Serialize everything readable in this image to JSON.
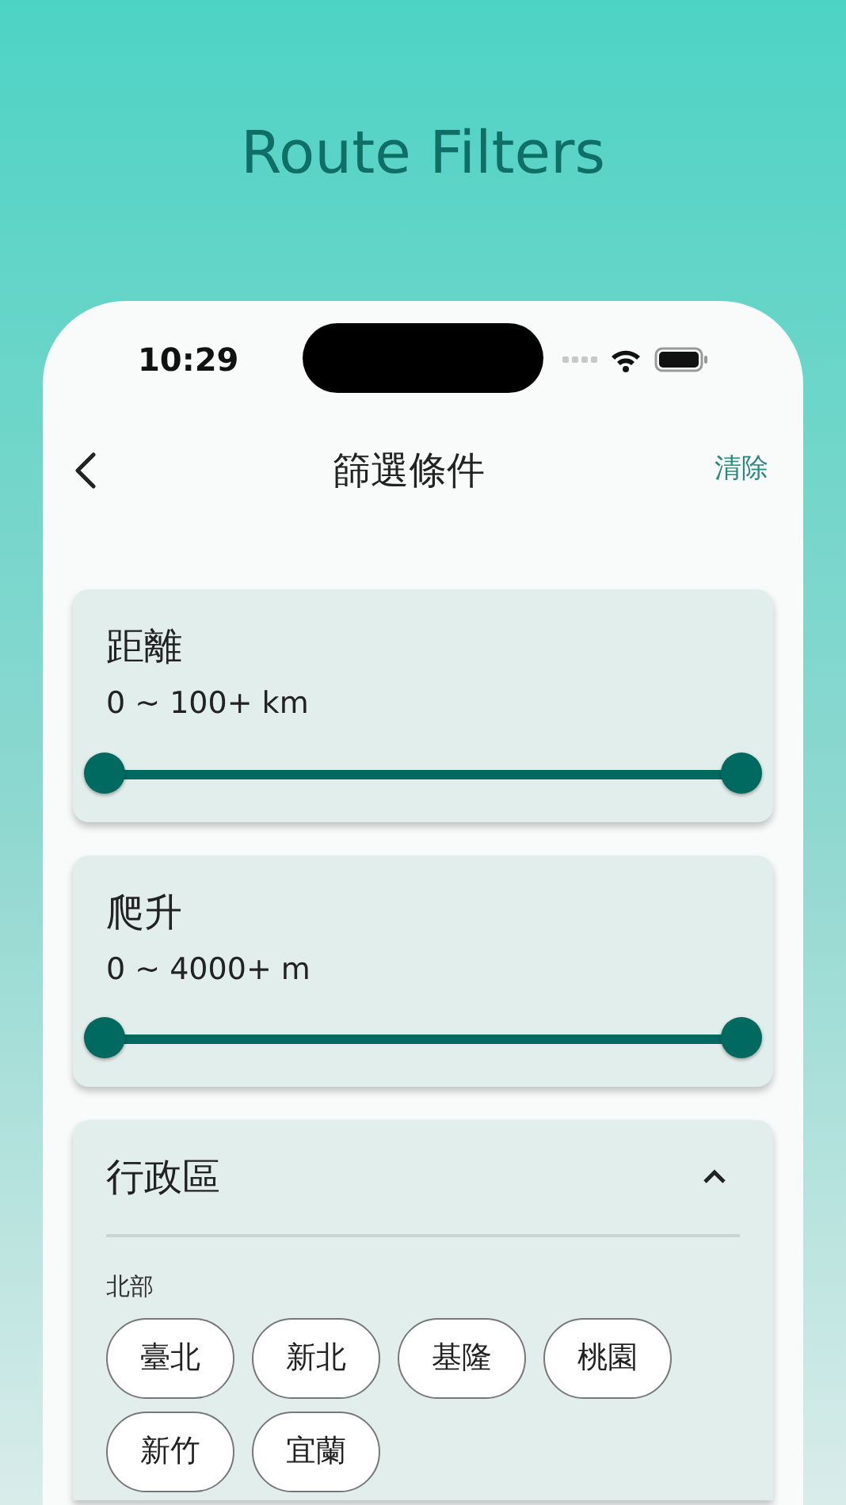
{
  "headline": "Route Filters",
  "status_bar": {
    "time": "10:29"
  },
  "nav": {
    "title": "篩選條件",
    "action": "清除"
  },
  "filters": [
    {
      "title": "距離",
      "reading": "0 ~ 100+ km",
      "thumbs": [
        {
          "level": 0
        },
        {
          "level": 1
        }
      ]
    },
    {
      "title": "爬升",
      "reading": "0 ~ 4000+ m",
      "thumbs": [
        {
          "level": 0
        },
        {
          "level": 1
        }
      ]
    }
  ],
  "region": {
    "title": "行政區",
    "expanded": true,
    "groups": [
      {
        "label": "北部",
        "chips": [
          {
            "label": "臺北",
            "selected": false
          },
          {
            "label": "新北",
            "selected": false
          },
          {
            "label": "基隆",
            "selected": false
          },
          {
            "label": "桃園",
            "selected": false
          },
          {
            "label": "新竹",
            "selected": false
          },
          {
            "label": "宜蘭",
            "selected": false
          }
        ]
      }
    ]
  }
}
